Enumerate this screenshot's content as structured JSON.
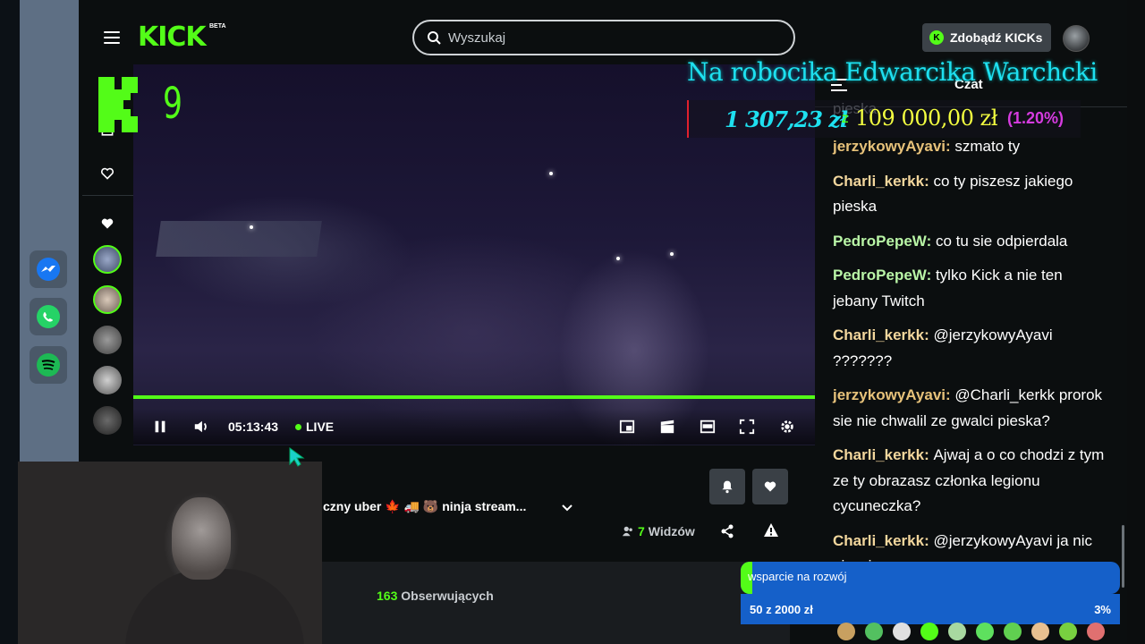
{
  "header": {
    "logo": "KICK",
    "logo_badge": "BETA",
    "search_placeholder": "Wyszukaj",
    "kicks_button": "Zdobądź KICKs",
    "kicks_icon": "K"
  },
  "overlay": {
    "counter": "9",
    "title": "Na robocika Edwarcika Warchcki",
    "raised": "1 307,23 zł",
    "goal_symbol": "Z",
    "goal": "109 000,00 zł",
    "percent": "(1.20%)"
  },
  "player": {
    "time": "05:13:43",
    "live_label": "LIVE"
  },
  "stream": {
    "title": "czny uber 🍁 🚚 🐻 ninja stream...",
    "viewers_count": "7",
    "viewers_label": "Widzów",
    "followers_count": "163",
    "followers_label": "Obserwujących"
  },
  "chat": {
    "header": "Czat",
    "partial_top": "pieska",
    "messages": [
      {
        "user": "jerzykowyAyavi",
        "text": "szmato ty",
        "color": "#e7c27a"
      },
      {
        "user": "Charli_kerkk",
        "text": "co ty piszesz jakiego pieska",
        "color": "#f3d79d"
      },
      {
        "user": "PedroPepeW",
        "text": "co tu sie odpierdala",
        "color": "#b9f5a6"
      },
      {
        "user": "PedroPepeW",
        "text": "tylko Kick a nie ten jebany Twitch",
        "color": "#b9f5a6"
      },
      {
        "user": "Charli_kerkk",
        "text": "@jerzykowyAyavi ???????",
        "color": "#f3d79d"
      },
      {
        "user": "jerzykowyAyavi",
        "text": "@Charli_kerkk prorok sie nie chwalil ze gwalci pieska?",
        "color": "#e7c27a"
      },
      {
        "user": "Charli_kerkk",
        "text": "Ajwaj a o co chodzi z tym ze ty obrazasz członka legionu cycuneczka?",
        "color": "#f3d79d"
      },
      {
        "user": "Charli_kerkk",
        "text": "@jerzykowyAyavi ja nic nie wiem",
        "color": "#f3d79d"
      }
    ]
  },
  "donation_goal": {
    "label": "wsparcie na rozwój",
    "amount": "50 z 2000 zł",
    "percent": "3%",
    "progress_fraction": 0.03
  },
  "colors": {
    "kick_green": "#53fc18",
    "goal_blue": "#1560c9",
    "overlay_cyan": "#1ee0f0",
    "overlay_yellow": "#f4ff40",
    "overlay_magenta": "#d63be0"
  }
}
